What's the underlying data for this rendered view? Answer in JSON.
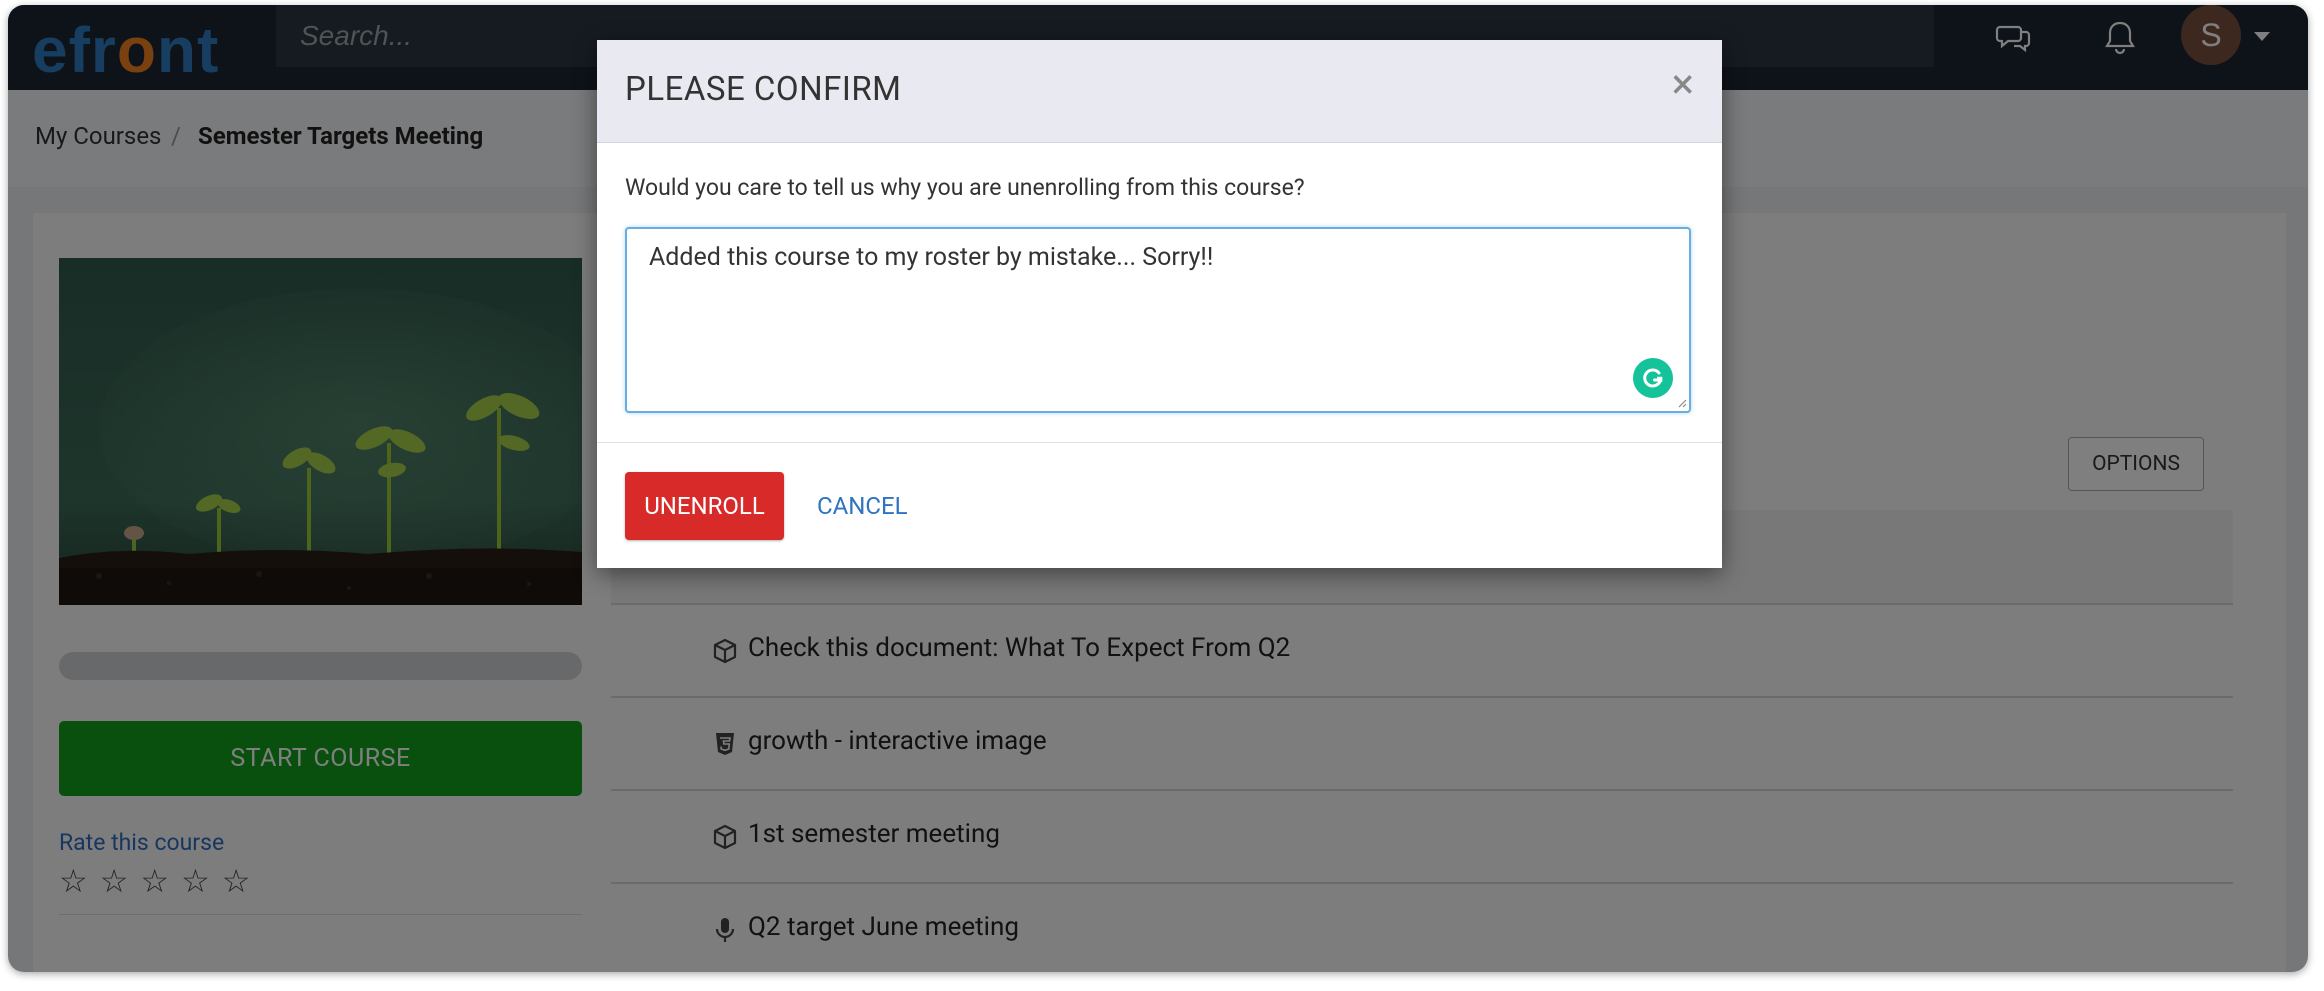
{
  "brand": {
    "logo_prefix": "efr",
    "logo_o": "o",
    "logo_suffix": "nt"
  },
  "search": {
    "placeholder": "Search..."
  },
  "header": {
    "avatar_initial": "S",
    "icons": [
      "chat-icon",
      "bell-icon"
    ]
  },
  "breadcrumb": {
    "parent": "My Courses",
    "separator": "/",
    "current": "Semester Targets Meeting"
  },
  "course": {
    "start_label": "START COURSE",
    "rate_label": "Rate this course",
    "rating": 0,
    "stars": [
      "☆",
      "☆",
      "☆",
      "☆",
      "☆"
    ],
    "options_label": "OPTIONS"
  },
  "units": [
    {
      "icon": "box-icon",
      "title": "Check this document: What To Expect From Q2"
    },
    {
      "icon": "html5-icon",
      "title": "growth - interactive image"
    },
    {
      "icon": "box-icon",
      "title": "1st semester meeting"
    },
    {
      "icon": "microphone-icon",
      "title": "Q2 target June meeting"
    }
  ],
  "modal": {
    "title": "PLEASE CONFIRM",
    "close": "×",
    "question": "Would you care to tell us why you are unenrolling from this course?",
    "reason_value": "Added this course to my roster by mistake... Sorry!!",
    "unenroll_label": "UNENROLL",
    "cancel_label": "CANCEL"
  },
  "colors": {
    "topbar": "#1c2733",
    "brand_blue": "#2f7bc1",
    "brand_orange": "#f58220",
    "start_green": "#12a11f",
    "unenroll_red": "#d92a2a",
    "link_blue": "#2f74c0"
  }
}
